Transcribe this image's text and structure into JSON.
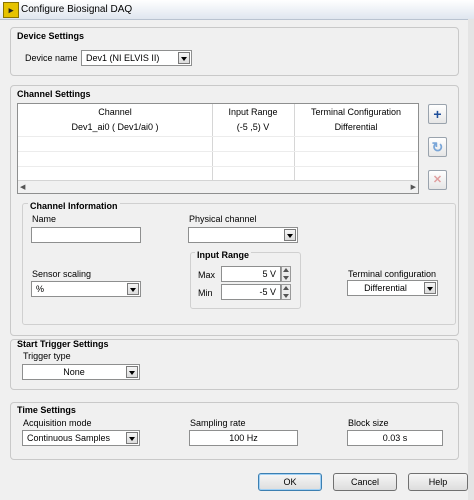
{
  "window": {
    "title": "Configure Biosignal DAQ",
    "icon": "labview-app-icon"
  },
  "device_settings": {
    "title": "Device Settings",
    "device_name_label": "Device name",
    "device_name_value": "Dev1 (NI ELVIS II)"
  },
  "channel_settings": {
    "title": "Channel Settings",
    "columns": [
      "Channel",
      "Input Range",
      "Terminal Configuration"
    ],
    "rows": [
      [
        "Dev1_ai0 ( Dev1/ai0 )",
        "(-5 ,5) V",
        "Differential"
      ]
    ],
    "buttons": {
      "add": "+",
      "refresh": "↻",
      "remove": "✕"
    }
  },
  "channel_information": {
    "title": "Channel Information",
    "name_label": "Name",
    "name_value": "",
    "physical_channel_label": "Physical channel",
    "physical_channel_value": "",
    "sensor_scaling_label": "Sensor scaling",
    "sensor_scaling_value": "%",
    "input_range_title": "Input Range",
    "max_label": "Max",
    "max_value": "5 V",
    "min_label": "Min",
    "min_value": "-5 V",
    "terminal_configuration_label": "Terminal configuration",
    "terminal_configuration_value": "Differential"
  },
  "start_trigger_settings": {
    "title": "Start Trigger Settings",
    "trigger_type_label": "Trigger type",
    "trigger_type_value": "None"
  },
  "time_settings": {
    "title": "Time Settings",
    "acquisition_mode_label": "Acquisition mode",
    "acquisition_mode_value": "Continuous Samples",
    "sampling_rate_label": "Sampling rate",
    "sampling_rate_value": "100 Hz",
    "block_size_label": "Block size",
    "block_size_value": "0.03 s"
  },
  "footer": {
    "ok": "OK",
    "cancel": "Cancel",
    "help": "Help"
  }
}
